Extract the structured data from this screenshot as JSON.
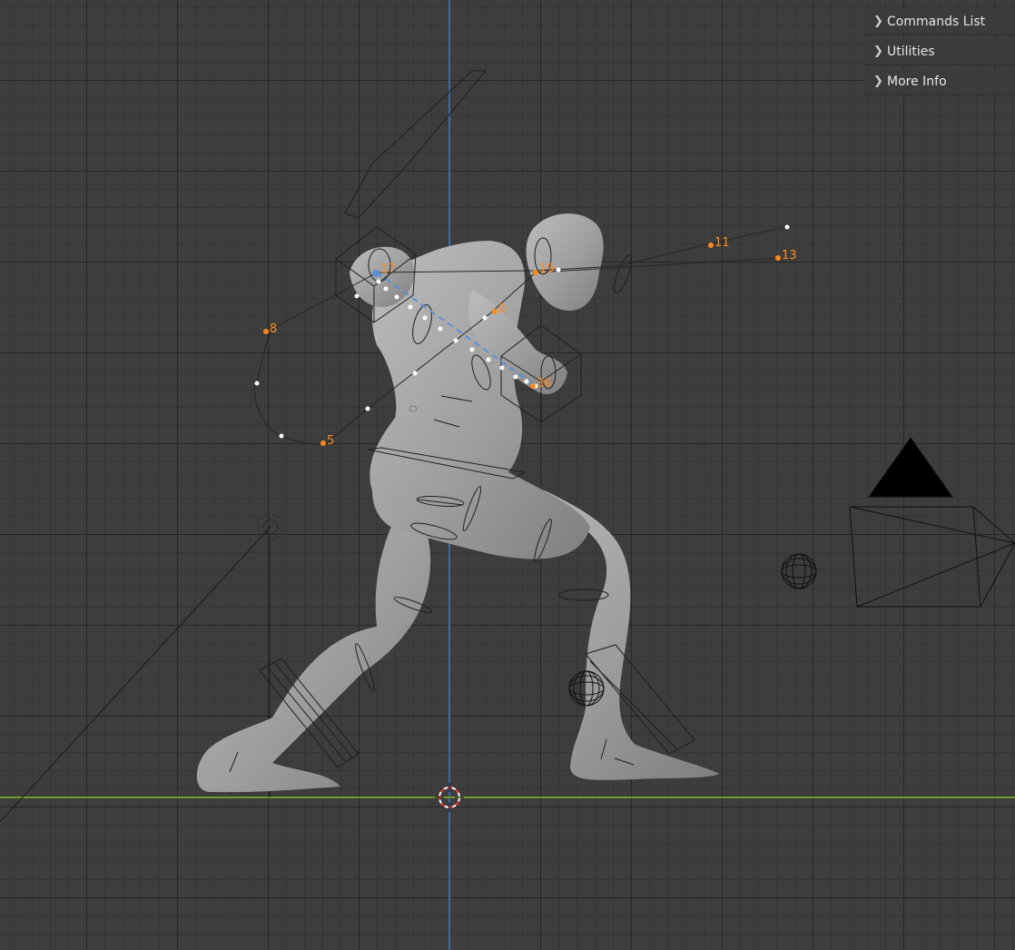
{
  "sidebar_panels": [
    {
      "label": "Commands List",
      "icon": "chevron-right-icon"
    },
    {
      "label": "Utilities",
      "icon": "chevron-right-icon"
    },
    {
      "label": "More Info",
      "icon": "chevron-right-icon"
    }
  ],
  "viewport": {
    "control_point_labels": [
      "11",
      "13",
      "8",
      "5",
      "0",
      "36",
      "17",
      "19"
    ],
    "colors": {
      "background": "#3d3d3d",
      "x_axis": "#6e9a2e",
      "z_axis": "#3d6aa6",
      "control_point": "#ff8a1e",
      "mesh": "#a3a3a3",
      "active_bone": "#5b8fd6"
    },
    "objects": [
      "character-mesh",
      "armature",
      "camera",
      "light",
      "3d-cursor",
      "empty-spheres"
    ]
  }
}
